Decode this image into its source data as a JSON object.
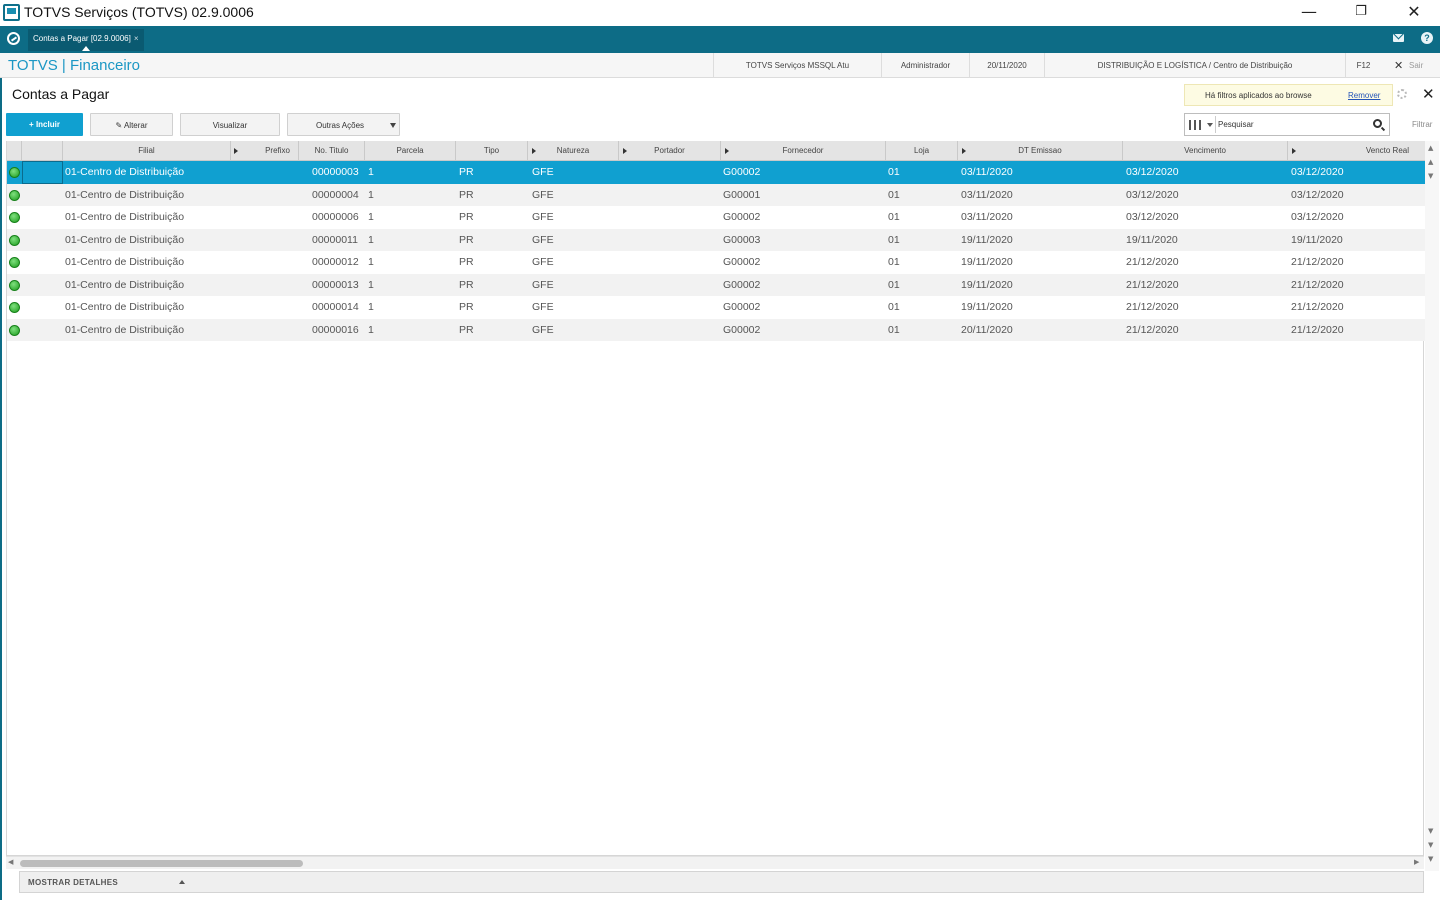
{
  "window": {
    "title": "TOTVS Serviços (TOTVS) 02.9.0006",
    "minimize_glyph": "—",
    "restore_glyph": "❐",
    "close_glyph": "✕"
  },
  "tabs": {
    "active_label": "Contas a Pagar [02.9.0006]",
    "close_glyph": "×"
  },
  "module": {
    "brand": "TOTVS | Financeiro",
    "environment": "TOTVS Serviços MSSQL Atu",
    "user": "Administrador",
    "date": "20/11/2020",
    "company": "DISTRIBUIÇÃO E LOGÍSTICA / Centro de Distribuição",
    "shortcut": "F12",
    "exit_glyph": "✕",
    "exit_label": "Sair",
    "help_glyph": "?"
  },
  "page": {
    "title": "Contas a Pagar",
    "close_glyph": "✕",
    "filter_notice": "Há filtros aplicados ao browse",
    "filter_remove": "Remover"
  },
  "toolbar": {
    "incluir": "+ Incluir",
    "alterar": "Alterar",
    "alterar_glyph": "✎",
    "visualizar": "Visualizar",
    "outras": "Outras Ações",
    "search_placeholder": "Pesquisar",
    "filter_label": "Filtrar"
  },
  "grid": {
    "columns": [
      "Filial",
      "Prefixo",
      "No. Titulo",
      "Parcela",
      "Tipo",
      "Natureza",
      "Portador",
      "Fornecedor",
      "Loja",
      "DT Emissao",
      "Vencimento",
      "Vencto Real"
    ],
    "rows": [
      {
        "filial": "01-Centro de Distribuição",
        "titulo": "00000003",
        "parcela": "1",
        "tipo": "PR",
        "natureza": "GFE",
        "fornecedor": "G00002",
        "loja": "01",
        "emissao": "03/11/2020",
        "vencimento": "03/12/2020",
        "vencto_real": "03/12/2020"
      },
      {
        "filial": "01-Centro de Distribuição",
        "titulo": "00000004",
        "parcela": "1",
        "tipo": "PR",
        "natureza": "GFE",
        "fornecedor": "G00001",
        "loja": "01",
        "emissao": "03/11/2020",
        "vencimento": "03/12/2020",
        "vencto_real": "03/12/2020"
      },
      {
        "filial": "01-Centro de Distribuição",
        "titulo": "00000006",
        "parcela": "1",
        "tipo": "PR",
        "natureza": "GFE",
        "fornecedor": "G00002",
        "loja": "01",
        "emissao": "03/11/2020",
        "vencimento": "03/12/2020",
        "vencto_real": "03/12/2020"
      },
      {
        "filial": "01-Centro de Distribuição",
        "titulo": "00000011",
        "parcela": "1",
        "tipo": "PR",
        "natureza": "GFE",
        "fornecedor": "G00003",
        "loja": "01",
        "emissao": "19/11/2020",
        "vencimento": "19/11/2020",
        "vencto_real": "19/11/2020"
      },
      {
        "filial": "01-Centro de Distribuição",
        "titulo": "00000012",
        "parcela": "1",
        "tipo": "PR",
        "natureza": "GFE",
        "fornecedor": "G00002",
        "loja": "01",
        "emissao": "19/11/2020",
        "vencimento": "21/12/2020",
        "vencto_real": "21/12/2020"
      },
      {
        "filial": "01-Centro de Distribuição",
        "titulo": "00000013",
        "parcela": "1",
        "tipo": "PR",
        "natureza": "GFE",
        "fornecedor": "G00002",
        "loja": "01",
        "emissao": "19/11/2020",
        "vencimento": "21/12/2020",
        "vencto_real": "21/12/2020"
      },
      {
        "filial": "01-Centro de Distribuição",
        "titulo": "00000014",
        "parcela": "1",
        "tipo": "PR",
        "natureza": "GFE",
        "fornecedor": "G00002",
        "loja": "01",
        "emissao": "19/11/2020",
        "vencimento": "21/12/2020",
        "vencto_real": "21/12/2020"
      },
      {
        "filial": "01-Centro de Distribuição",
        "titulo": "00000016",
        "parcela": "1",
        "tipo": "PR",
        "natureza": "GFE",
        "fornecedor": "G00002",
        "loja": "01",
        "emissao": "20/11/2020",
        "vencimento": "21/12/2020",
        "vencto_real": "21/12/2020"
      }
    ]
  },
  "details": {
    "label": "MOSTRAR DETALHES"
  },
  "colors": {
    "accent": "#10a0d0",
    "tabstrip": "#0d6c86",
    "status_ok": "#1d9c1d"
  }
}
